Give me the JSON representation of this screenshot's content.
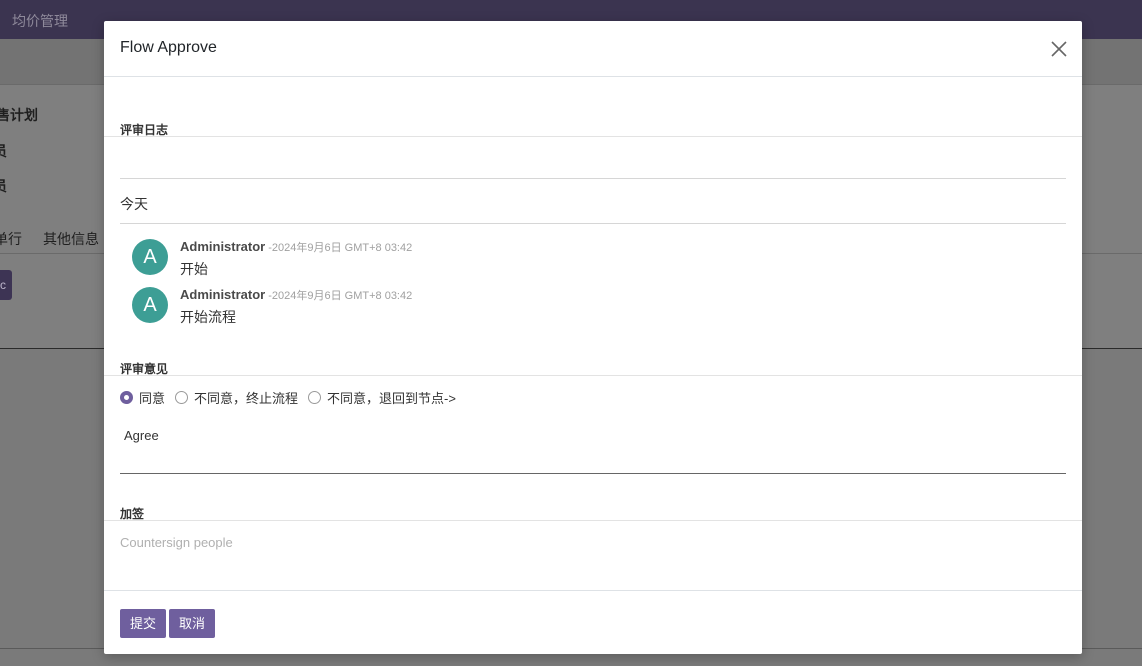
{
  "background": {
    "app_title": "均价管理",
    "field_labels": [
      "售计划",
      "员",
      "员"
    ],
    "tabs": [
      "单行",
      "其他信息"
    ],
    "button_fragment": "c"
  },
  "modal": {
    "title": "Flow Approve",
    "review_log_label": "评审日志",
    "day_label": "今天",
    "messages": [
      {
        "avatar_letter": "A",
        "author": "Administrator",
        "date": "-2024年9月6日 GMT+8 03:42",
        "body": "开始"
      },
      {
        "avatar_letter": "A",
        "author": "Administrator",
        "date": "-2024年9月6日 GMT+8 03:42",
        "body": "开始流程"
      }
    ],
    "review_opinion_label": "评审意见",
    "options": [
      {
        "label": "同意",
        "checked": true
      },
      {
        "label": "不同意，终止流程",
        "checked": false
      },
      {
        "label": "不同意，退回到节点->",
        "checked": false
      }
    ],
    "opinion_value": "Agree",
    "countersign_label": "加签",
    "countersign_placeholder": "Countersign people",
    "submit_label": "提交",
    "cancel_label": "取消"
  },
  "colors": {
    "accent": "#6f5f9e",
    "avatar": "#3d9e95",
    "navbar": "#3b3450"
  },
  "icons": {
    "close": "close-icon"
  }
}
